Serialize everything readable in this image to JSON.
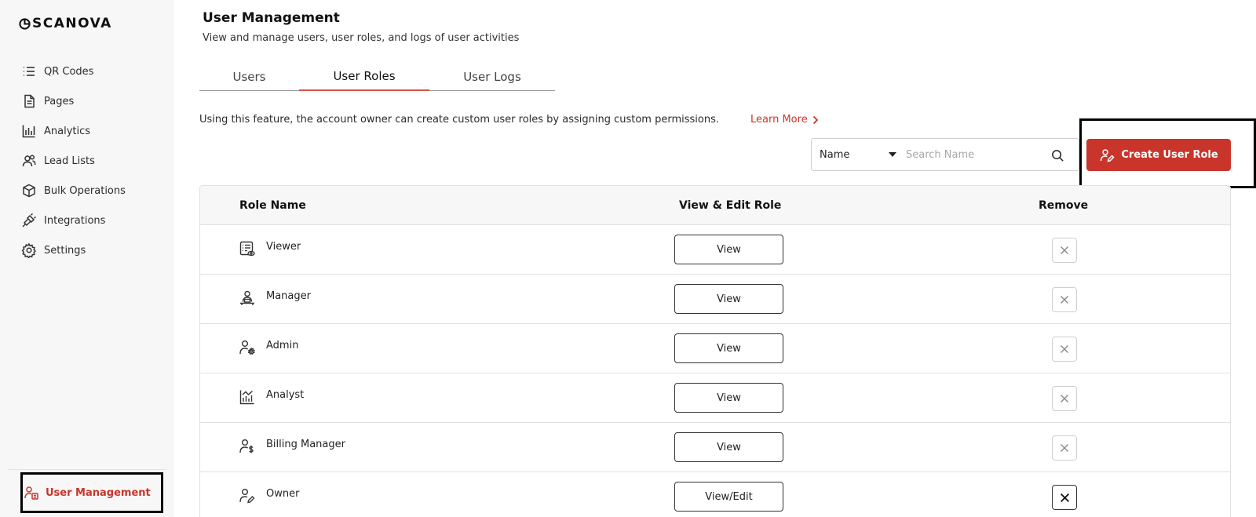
{
  "brand": {
    "name": "SCANOVA",
    "accent": "#c9352b"
  },
  "sidebar": {
    "items": [
      {
        "label": "QR Codes",
        "icon": "list-icon"
      },
      {
        "label": "Pages",
        "icon": "document-icon"
      },
      {
        "label": "Analytics",
        "icon": "bar-chart-icon"
      },
      {
        "label": "Lead Lists",
        "icon": "users-icon"
      },
      {
        "label": "Bulk Operations",
        "icon": "cube-icon"
      },
      {
        "label": "Integrations",
        "icon": "plug-icon"
      },
      {
        "label": "Settings",
        "icon": "gear-icon"
      }
    ],
    "active_item": {
      "label": "User Management",
      "icon": "user-management-icon"
    }
  },
  "header": {
    "title": "User Management",
    "subtitle": "View and manage users, user roles, and logs of user activities"
  },
  "tabs": [
    {
      "label": "Users"
    },
    {
      "label": "User Roles",
      "active": true
    },
    {
      "label": "User Logs"
    }
  ],
  "info": {
    "text": "Using this feature, the account owner can create custom user roles by assigning custom permissions.",
    "learn_more": "Learn More"
  },
  "filter": {
    "selected": "Name",
    "search_placeholder": "Search Name"
  },
  "create_button": {
    "label": "Create User Role"
  },
  "table": {
    "headers": [
      "Role Name",
      "View & Edit Role",
      "Remove"
    ],
    "rows": [
      {
        "name": "Viewer",
        "action": "View",
        "icon": "viewer-icon"
      },
      {
        "name": "Manager",
        "action": "View",
        "icon": "manager-icon"
      },
      {
        "name": "Admin",
        "action": "View",
        "icon": "admin-icon"
      },
      {
        "name": "Analyst",
        "action": "View",
        "icon": "analyst-icon"
      },
      {
        "name": "Billing Manager",
        "action": "View",
        "icon": "billing-manager-icon"
      },
      {
        "name": "Owner",
        "action": "View/Edit",
        "icon": "owner-icon"
      }
    ]
  }
}
